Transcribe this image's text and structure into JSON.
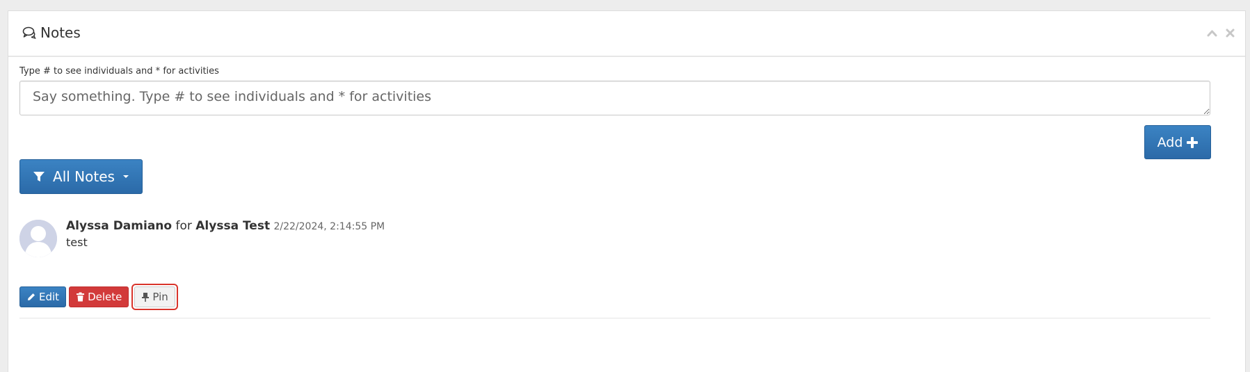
{
  "panel": {
    "title": "Notes",
    "title_icon": "comments-icon",
    "collapse_icon": "chevron-up-icon",
    "close_icon": "close-icon"
  },
  "composer": {
    "label": "Type # to see individuals and * for activities",
    "placeholder": "Say something. Type # to see individuals and * for activities",
    "value": "",
    "add_label": "Add",
    "add_icon": "plus-icon"
  },
  "filter": {
    "label": "All Notes",
    "icon": "filter-icon",
    "caret_icon": "caret-down-icon"
  },
  "notes": [
    {
      "author": "Alyssa Damiano",
      "connector": "for",
      "subject": "Alyssa Test",
      "timestamp": "2/22/2024, 2:14:55 PM",
      "text": "test",
      "actions": {
        "edit": "Edit",
        "delete": "Delete",
        "pin": "Pin"
      }
    }
  ],
  "colors": {
    "primary": "#2f75b5",
    "danger": "#d23a3a",
    "highlight": "#d9342b",
    "avatar": "#ced3e6"
  }
}
